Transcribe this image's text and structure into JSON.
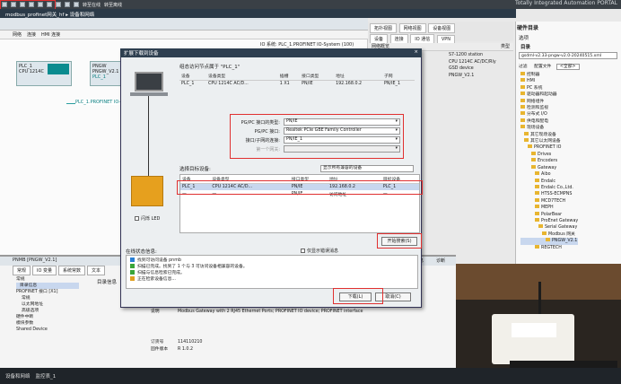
{
  "toolbar": {
    "items": [
      "项目",
      "编辑",
      "视图",
      "插入",
      "在线",
      "选项",
      "工具",
      "窗口",
      "帮助"
    ],
    "go_online": "转至在线",
    "go_offline": "转至离线",
    "branding": "Totally Integrated Automation PORTAL"
  },
  "breadcrumb": "modbus_profinet网关_hf ▸ 设备和网络",
  "editor": {
    "network_label": "网络",
    "connection_label": "连接",
    "connection_value": "HMI 连接",
    "io_system": "IO 系统: PLC_1.PROFINET IO-System (100)"
  },
  "overview": {
    "tabs": [
      "拓扑视图",
      "网络视图",
      "设备视图"
    ],
    "subtabs": [
      "设备",
      "连接",
      "IO 通信",
      "VPN"
    ],
    "header_label": "网络概览",
    "col_type": "类型",
    "items": [
      "S7-1200 station",
      "CPU 1214C AC/DC/Rly",
      "GSD device",
      "PNGW_V2.1"
    ]
  },
  "devices": {
    "plc_name": "PLC_1",
    "plc_type": "CPU 1214C",
    "gw_name": "PNGW",
    "gw_type": "PNGW_V2.1",
    "gw_link": "PLC_1",
    "net_label": "PLC_1.PROFINET IO-Syst..."
  },
  "dialog": {
    "title": "扩展下载到设备",
    "close": "×",
    "conn_title": "组态访问节点属于 \"PLC_1\"",
    "t1_headers": [
      "设备",
      "设备类型",
      "插槽",
      "接口类型",
      "地址",
      "子网"
    ],
    "t1_row": [
      "PLC_1",
      "CPU 1214C AC/D...",
      "1 X1",
      "PN/IE",
      "192.168.0.2",
      "PN/IE_1"
    ],
    "param_labels": [
      "PG/PC 接口的类型:",
      "PG/PC 接口:",
      "接口/子网的连接:",
      "第一个网关:"
    ],
    "param_values": [
      "PN/IE",
      "Realtek PCIe GBE Family Controller",
      "PN/IE_1",
      ""
    ],
    "select_label": "选择目标设备:",
    "filter": "显示所有兼容的设备",
    "t2_headers": [
      "设备",
      "设备类型",
      "接口类型",
      "地址",
      "目标设备"
    ],
    "t2_rows": [
      [
        "PLC_1",
        "CPU 1214C AC/D...",
        "PN/IE",
        "192.168.0.2",
        "PLC_1"
      ],
      [
        "—",
        "—",
        "PN/IE",
        "访问地址",
        "—"
      ]
    ],
    "flash_led": "闪烁 LED",
    "start_search": "开始搜索(S)",
    "status_label": "在线状态信息:",
    "show_all": "仅显示错误消息",
    "messages": [
      "找到可访问设备 pnmb",
      "扫描已完成。找到了 1 个与 3 可访问设备相兼容的设备。",
      "扫描与信息检索已完成。",
      "正在检索设备信息..."
    ],
    "load_btn": "下载(L)",
    "cancel_btn": "取消(C)"
  },
  "props": {
    "title": "PNMB [PNGW_V2.1]",
    "tabs": [
      "常规",
      "IO 变量",
      "系统常数",
      "文本"
    ],
    "panel_tabs": [
      "属性",
      "信息",
      "诊断"
    ],
    "tree": [
      "常规",
      "目录信息",
      "PROFINET 接口 [X1]",
      "常规",
      "以太网地址",
      "高级选项",
      "硬件中断",
      "模块参数",
      "Shared Device"
    ],
    "heading": "目录信息",
    "desc_label": "说明",
    "desc": "Modbus Gateway with 2 RJ45 Ethernet Ports; PROFINET IO device; PROFINET interface",
    "order_label": "订货号",
    "order_value": "114110210",
    "fw_label": "固件版本",
    "fw_value": "R 1.0.2"
  },
  "catalog": {
    "title": "硬件目录",
    "option_label": "选项",
    "dir_label": "目录",
    "search": "gsdml-v2.33-pngw-v2.0-20240515.xml",
    "filter_label": "过滤",
    "profile": "配置文件",
    "profile_value": "<全部>",
    "tree": [
      "控制器",
      "HMI",
      "PC 系统",
      "驱动器和起动器",
      "网络组件",
      "检测和监视",
      "分布式 I/O",
      "供电和配电",
      "现场设备",
      "其它现场设备",
      "其它以太网设备",
      "PROFINET IO",
      "Drives",
      "Encoders",
      "Gateway",
      "Aibo",
      "Endalc",
      "Endalc Co.,Ltd.",
      "HTSS-ECMPNS",
      "MCD7TECH",
      "MEPH",
      "PolarBear",
      "ProEnet Gateway",
      "Serial Gateway",
      "Modbus 网关",
      "PNGW_V2.1",
      "REGTECH"
    ]
  },
  "statusbar": [
    "设备和网络",
    "监控表_1"
  ],
  "colors": {
    "accent": "#e03030",
    "teal": "#0a8b8f",
    "titlebar": "#2e3f50"
  }
}
